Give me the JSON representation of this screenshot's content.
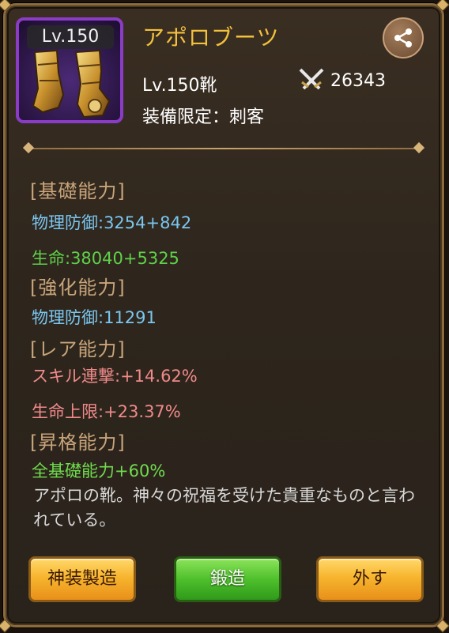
{
  "item": {
    "level_tag": "Lv.150",
    "name": "アポロブーツ",
    "subtype": "Lv.150靴",
    "power": "26343",
    "restriction": "装備限定：刺客",
    "description": "アポロの靴。神々の祝福を受けた貴重なものと言われている。",
    "icon": "boots-icon",
    "rarity_color": "#8a3cc7"
  },
  "sections": {
    "base": {
      "title": "[基礎能力]",
      "stat1": "物理防御:3254+842",
      "stat2": "生命:38040+5325"
    },
    "enhance": {
      "title": "[強化能力]",
      "stat1": "物理防御:11291"
    },
    "rare": {
      "title": "[レア能力]",
      "stat1": "スキル連撃:+14.62%",
      "stat2": "生命上限:+23.37%"
    },
    "ascend": {
      "title": "[昇格能力]",
      "stat1": "全基礎能力+60%"
    }
  },
  "buttons": {
    "divine_craft": "神装製造",
    "forge": "鍛造",
    "unequip": "外す"
  },
  "colors": {
    "title": "#f2c13c",
    "blue_stat": "#7ac6f0",
    "green_stat": "#5fd14a",
    "rare_stat": "#f08a8a"
  }
}
